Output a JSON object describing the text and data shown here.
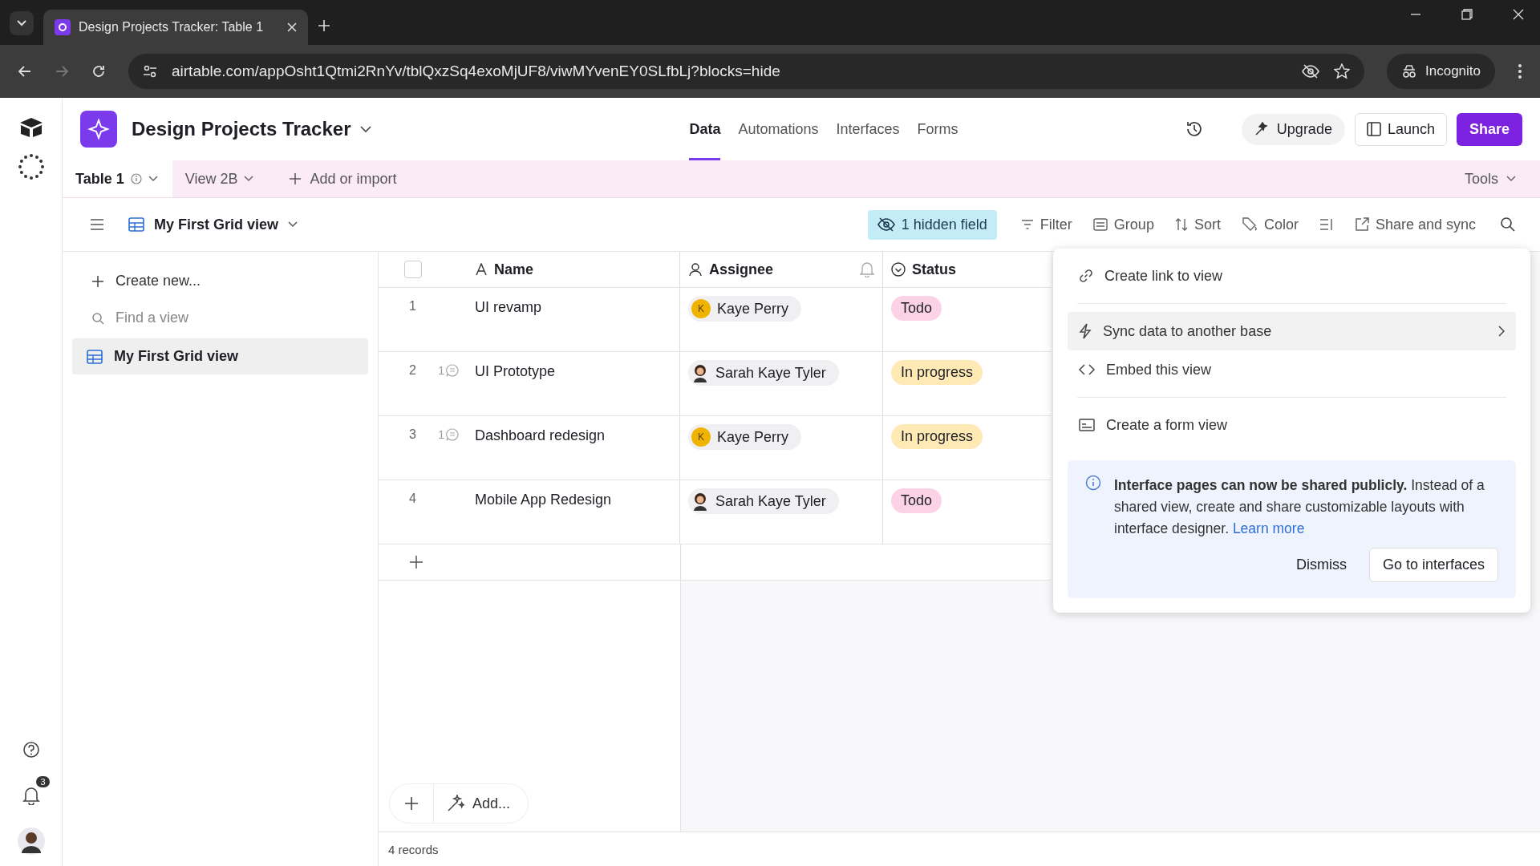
{
  "browser": {
    "tab_title": "Design Projects Tracker: Table 1",
    "url": "airtable.com/appOsht1Qtmi2RnYv/tblQxzSq4exoMjUF8/viwMYvenEY0SLfbLj?blocks=hide",
    "profile": "Incognito"
  },
  "header": {
    "base_name": "Design Projects Tracker",
    "nav": [
      {
        "label": "Data",
        "selected": true
      },
      {
        "label": "Automations",
        "selected": false
      },
      {
        "label": "Interfaces",
        "selected": false
      },
      {
        "label": "Forms",
        "selected": false
      }
    ],
    "upgrade": "Upgrade",
    "launch": "Launch",
    "share": "Share"
  },
  "table_tabs": {
    "tabs": [
      {
        "label": "Table 1",
        "selected": true
      },
      {
        "label": "View 2B",
        "selected": false
      }
    ],
    "add": "Add or import",
    "tools": "Tools"
  },
  "view_bar": {
    "view_name": "My First Grid view",
    "hidden_fields": "1 hidden field",
    "tools": [
      {
        "kind": "filter",
        "label": "Filter"
      },
      {
        "kind": "group",
        "label": "Group"
      },
      {
        "kind": "sort",
        "label": "Sort"
      },
      {
        "kind": "color",
        "label": "Color"
      },
      {
        "kind": "height"
      },
      {
        "kind": "share",
        "label": "Share and sync"
      }
    ]
  },
  "sidebar": {
    "create": "Create new...",
    "search_placeholder": "Find a view",
    "views": [
      {
        "label": "My First Grid view",
        "selected": true
      }
    ]
  },
  "rail": {
    "notification_count": "3"
  },
  "grid": {
    "select_all": {
      "checked": false
    },
    "columns": [
      {
        "kind": "text",
        "label": "Name"
      },
      {
        "kind": "user",
        "label": "Assignee"
      },
      {
        "kind": "status",
        "label": "Status"
      }
    ],
    "rows": [
      {
        "number": "1",
        "name": "UI revamp",
        "assignee": {
          "name": "Kaye Perry",
          "initial": "K"
        },
        "status": {
          "label": "Todo",
          "color": "#fcd3e6"
        }
      },
      {
        "number": "2",
        "comments": "1",
        "name": "UI Prototype",
        "assignee": {
          "name": "Sarah Kaye Tyler"
        },
        "status": {
          "label": "In progress",
          "color": "#ffeab6"
        }
      },
      {
        "number": "3",
        "comments": "1",
        "name": "Dashboard redesign",
        "assignee": {
          "name": "Kaye Perry",
          "initial": "K"
        },
        "status": {
          "label": "In progress",
          "color": "#ffeab6"
        }
      },
      {
        "number": "4",
        "name": "Mobile App Redesign",
        "assignee": {
          "name": "Sarah Kaye Tyler"
        },
        "status": {
          "label": "Todo",
          "color": "#fcd3e6"
        }
      }
    ],
    "add_label": "Add...",
    "record_count": "4 records"
  },
  "menu": {
    "sections": [
      {
        "items": [
          {
            "kind": "link",
            "label": "Create link to view",
            "submenu": false,
            "hovered": false
          }
        ]
      },
      {
        "items": [
          {
            "kind": "sync",
            "label": "Sync data to another base",
            "submenu": true,
            "hovered": true
          },
          {
            "kind": "embed",
            "label": "Embed this view",
            "submenu": false,
            "hovered": false
          }
        ]
      },
      {
        "items": [
          {
            "kind": "form",
            "label": "Create a form view",
            "submenu": false,
            "hovered": false
          }
        ]
      }
    ],
    "notice": {
      "text": "**Interface pages can now be shared publicly.** Instead of a shared view, create and share customizable layouts with interface designer.",
      "link": "Learn more",
      "dismiss": "Dismiss",
      "action": "Go to interfaces"
    }
  }
}
